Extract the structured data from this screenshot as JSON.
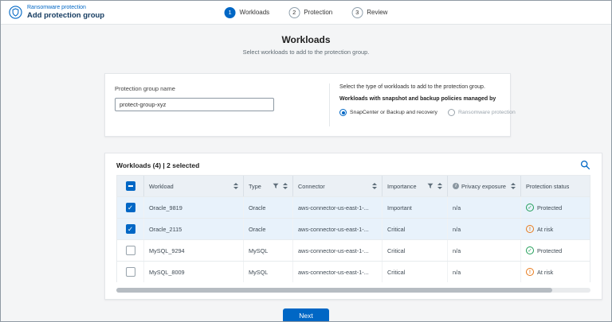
{
  "header": {
    "app_title": "Ransomware protection",
    "page_title": "Add protection group",
    "steps": [
      {
        "number": "1",
        "label": "Workloads",
        "active": true
      },
      {
        "number": "2",
        "label": "Protection",
        "active": false
      },
      {
        "number": "3",
        "label": "Review",
        "active": false
      }
    ]
  },
  "main": {
    "title": "Workloads",
    "subtitle": "Select workloads to add to the protection group.",
    "form": {
      "name_label": "Protection group name",
      "name_value": "protect-group-xyz",
      "type_prompt": "Select the type of workloads to add to the protection group.",
      "managed_by_label": "Workloads with snapshot and backup policies managed by",
      "radio_options": [
        {
          "label": "SnapCenter or Backup and recovery",
          "selected": true
        },
        {
          "label": "Ransomware protection",
          "selected": false
        }
      ]
    },
    "table": {
      "summary": "Workloads (4) | 2 selected",
      "select_all_state": "indeterminate",
      "columns": [
        "Workload",
        "Type",
        "Connector",
        "Importance",
        "Privacy exposure",
        "Protection status"
      ],
      "rows": [
        {
          "name": "Oracle_9819",
          "type": "Oracle",
          "connector": "aws-connector-us-east-1-...",
          "importance": "Important",
          "privacy_exposure": "n/a",
          "protection_status": "Protected",
          "checked": true
        },
        {
          "name": "Oracle_2115",
          "type": "Oracle",
          "connector": "aws-connector-us-east-1-...",
          "importance": "Critical",
          "privacy_exposure": "n/a",
          "protection_status": "At risk",
          "checked": true
        },
        {
          "name": "MySQL_9294",
          "type": "MySQL",
          "connector": "aws-connector-us-east-1-...",
          "importance": "Critical",
          "privacy_exposure": "n/a",
          "protection_status": "Protected",
          "checked": false
        },
        {
          "name": "MySQL_8009",
          "type": "MySQL",
          "connector": "aws-connector-us-east-1-...",
          "importance": "Critical",
          "privacy_exposure": "n/a",
          "protection_status": "At risk",
          "checked": false
        }
      ]
    },
    "next_label": "Next"
  },
  "icons": {
    "app": "shield-in-circle",
    "search": "magnifier",
    "filter": "funnel",
    "sort": "up-down-triangles",
    "privacy_info": "info-circle",
    "protected": "check-circle-green",
    "at_risk": "alert-circle-orange"
  },
  "colors": {
    "primary": "#0067C5",
    "success": "#1F9D57",
    "warning": "#E8791A",
    "selected_row": "#E8F2FB",
    "table_header_bg": "#EBF0F5"
  }
}
